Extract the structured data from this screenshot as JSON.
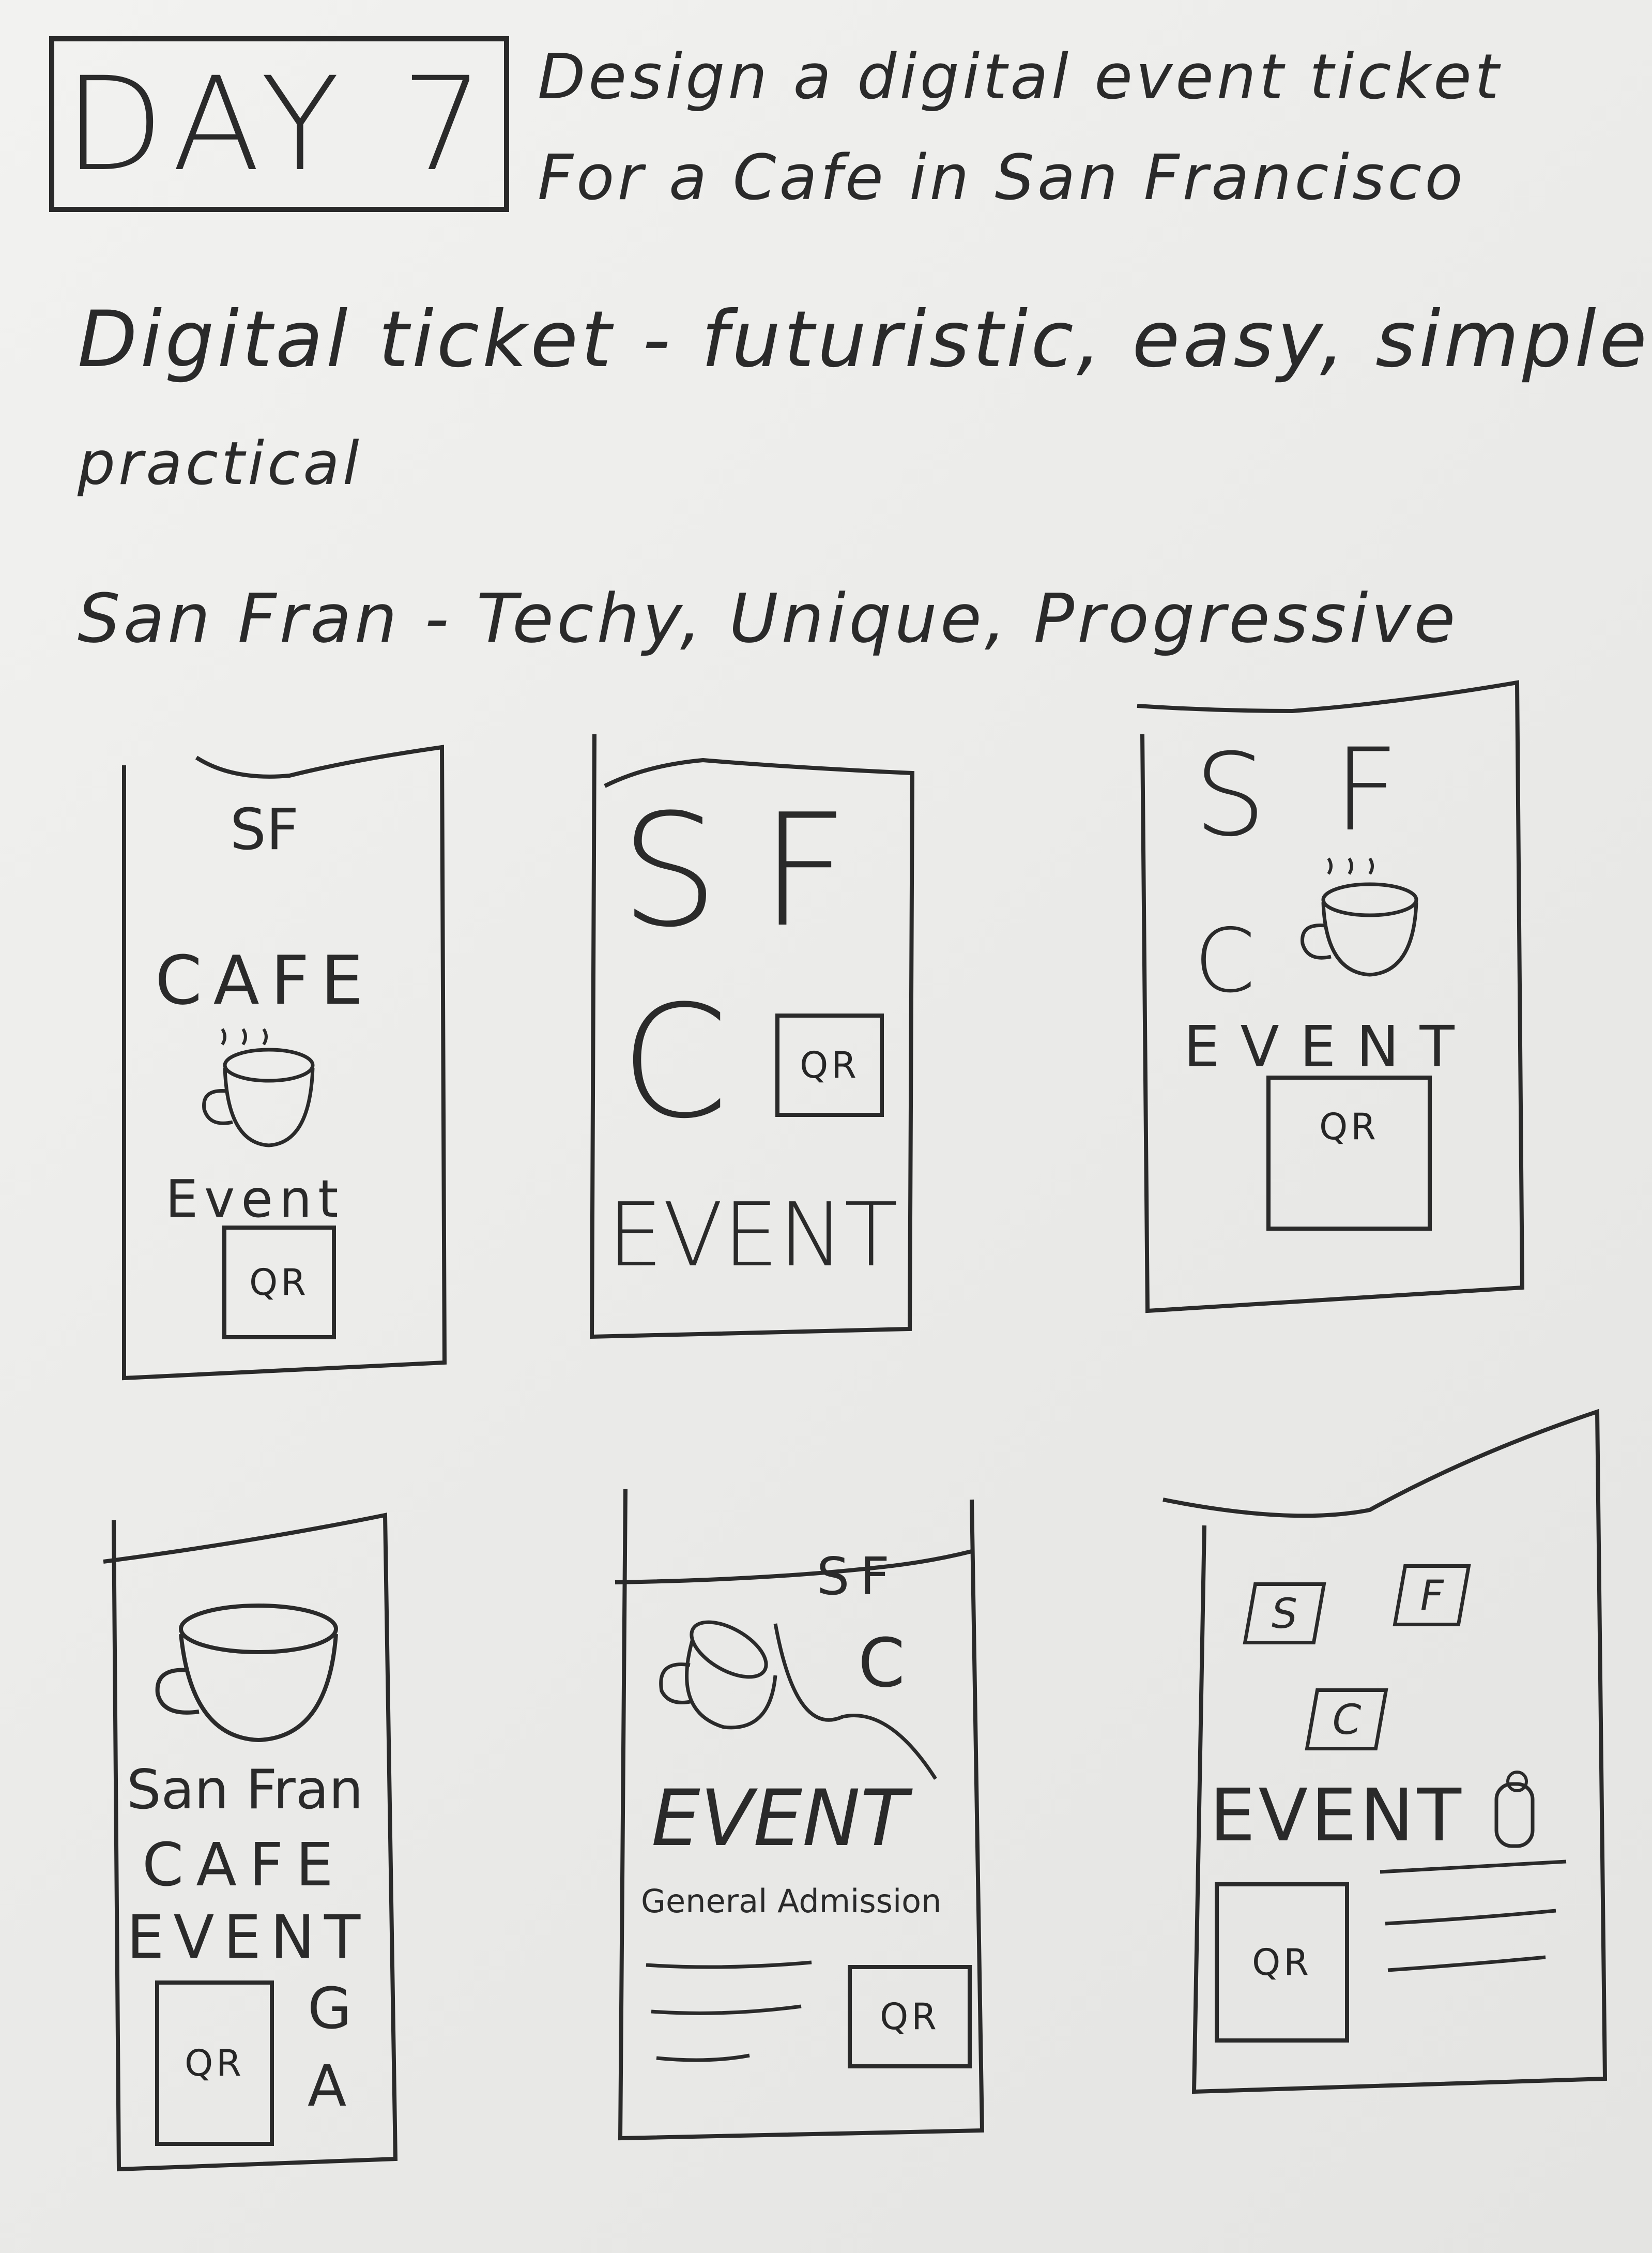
{
  "header": {
    "day_label": "DAY 7",
    "prompt_line_1": "Design a digital event ticket",
    "prompt_line_2": "For a Cafe in San Francisco"
  },
  "notes": {
    "line_1": "Digital ticket - futuristic, easy, simple",
    "line_2": "practical",
    "line_3": "San Fran - Techy, Unique, Progressive"
  },
  "sketches": [
    {
      "logo": "SF",
      "title": "CAFE",
      "event_label": "Event",
      "qr_label": "QR"
    },
    {
      "logo_s": "S",
      "logo_f": "F",
      "logo_c": "C",
      "event_label": "EVENT",
      "qr_label": "QR"
    },
    {
      "logo_s": "S",
      "logo_f": "F",
      "logo_c": "C",
      "event_label": "EVENT",
      "qr_label": "QR"
    },
    {
      "line_1": "San Fran",
      "line_2": "CAFE",
      "line_3": "EVENT",
      "qr_label": "QR",
      "side_1": "G",
      "side_2": "A"
    },
    {
      "logo": "SF",
      "logo_c": "C",
      "event_label": "EVENT",
      "subtitle": "General Admission",
      "qr_label": "QR"
    },
    {
      "cube_1": "S",
      "cube_2": "F",
      "cube_3": "C",
      "event_label": "EVENT",
      "qr_label": "QR"
    }
  ],
  "colors": {
    "ink": "#2a2a2a",
    "paper": "#eeeeec"
  }
}
